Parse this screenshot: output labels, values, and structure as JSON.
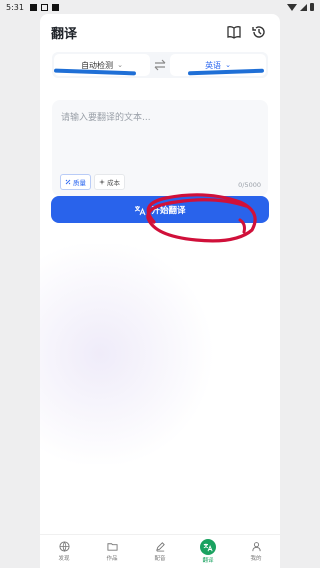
{
  "status_bar": {
    "time": "5:31"
  },
  "header": {
    "title": "翻译"
  },
  "language": {
    "source": "自动检测",
    "target": "英语"
  },
  "input": {
    "placeholder": "请输入要翻译的文本...",
    "counter": "0/5000"
  },
  "tags": [
    {
      "label": "质量"
    },
    {
      "label": "成本"
    }
  ],
  "action": {
    "start_label": "开始翻译"
  },
  "tabbar": [
    {
      "label": "发现",
      "icon": "globe-icon"
    },
    {
      "label": "作品",
      "icon": "folder-icon"
    },
    {
      "label": "配音",
      "icon": "pen-icon"
    },
    {
      "label": "翻译",
      "icon": "translate-icon"
    },
    {
      "label": "我的",
      "icon": "user-icon"
    }
  ],
  "colors": {
    "accent": "#2963eb",
    "tab_active": "#1aa260",
    "annotation_red": "#d0103a",
    "annotation_blue": "#1f6fd6"
  }
}
